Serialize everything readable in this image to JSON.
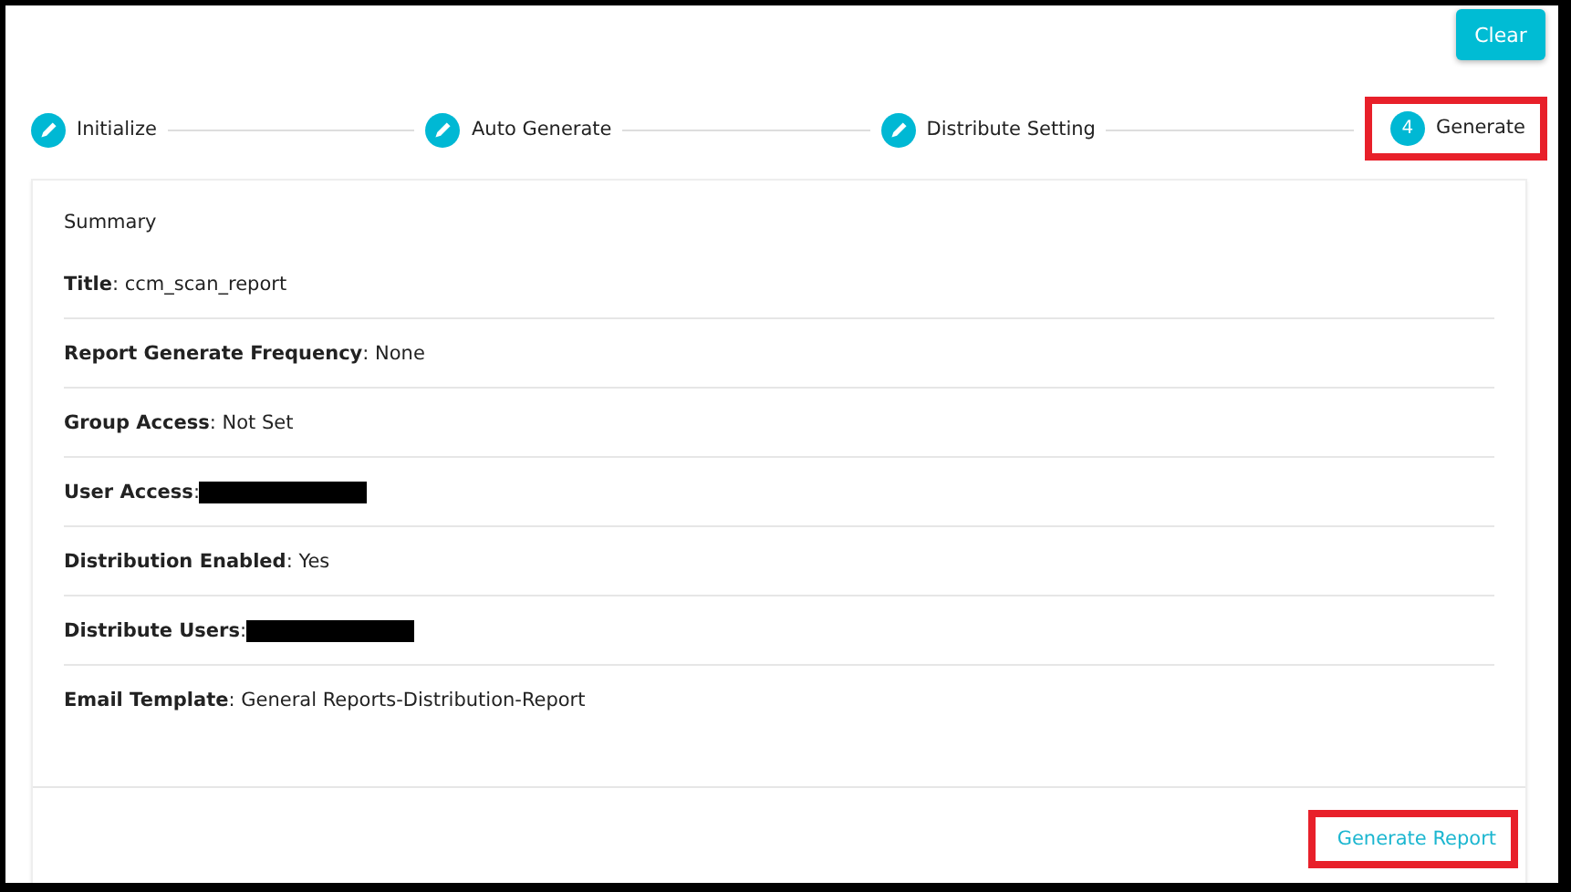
{
  "toolbar": {
    "clear_button": "Clear"
  },
  "steps": [
    {
      "label": "Initialize",
      "kind": "edit",
      "highlighted": false
    },
    {
      "label": "Auto Generate",
      "kind": "edit",
      "highlighted": false
    },
    {
      "label": "Distribute Setting",
      "kind": "edit",
      "highlighted": false
    },
    {
      "label": "Generate",
      "kind": "number",
      "number": "4",
      "highlighted": true
    }
  ],
  "summary": {
    "heading": "Summary",
    "fields": [
      {
        "text": "**Title**: ccm_scan_report",
        "redacted": false
      },
      {
        "text": "**Report Generate Frequency**: None",
        "redacted": false
      },
      {
        "text": "**Group Access**: Not Set",
        "redacted": false
      },
      {
        "text": "**User Access**:",
        "redacted": true
      },
      {
        "text": "**Distribution Enabled**: Yes",
        "redacted": false
      },
      {
        "text": "**Distribute Users**:",
        "redacted": true
      },
      {
        "text": "**Email Template**: General Reports-Distribution-Report",
        "redacted": false
      }
    ]
  },
  "footer": {
    "generate_button": {
      "label": "Generate Report",
      "highlighted": true
    }
  }
}
